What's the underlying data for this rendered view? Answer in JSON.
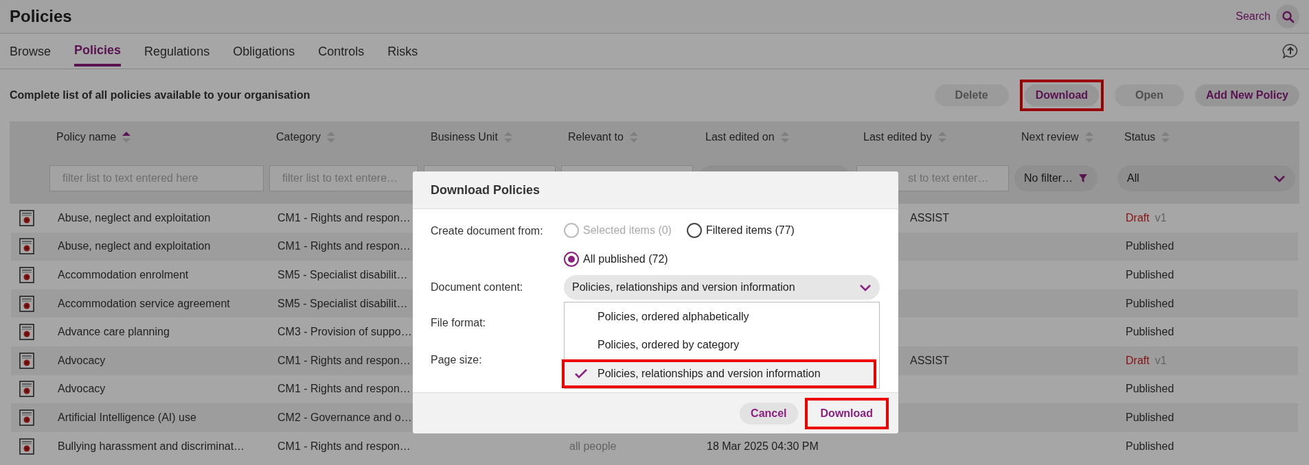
{
  "header": {
    "title": "Policies",
    "search_label": "Search"
  },
  "tabs": [
    {
      "label": "Browse",
      "selected": false
    },
    {
      "label": "Policies",
      "selected": true
    },
    {
      "label": "Regulations",
      "selected": false
    },
    {
      "label": "Obligations",
      "selected": false
    },
    {
      "label": "Controls",
      "selected": false
    },
    {
      "label": "Risks",
      "selected": false
    }
  ],
  "toolbar": {
    "description": "Complete list of all policies available to your organisation",
    "buttons": [
      {
        "label": "Delete",
        "disabled": true,
        "highlighted": false
      },
      {
        "label": "Download",
        "disabled": false,
        "highlighted": true
      },
      {
        "label": "Open",
        "disabled": true,
        "highlighted": false
      },
      {
        "label": "Add New Policy",
        "disabled": false,
        "highlighted": false
      }
    ]
  },
  "table": {
    "columns": [
      {
        "label": "Policy name",
        "sorted_ascending": true
      },
      {
        "label": "Category",
        "sorted_ascending": false
      },
      {
        "label": "Business Unit",
        "sorted_ascending": false
      },
      {
        "label": "Relevant to",
        "sorted_ascending": false
      },
      {
        "label": "Last edited on",
        "sorted_ascending": false
      },
      {
        "label": "Last edited by",
        "sorted_ascending": false
      },
      {
        "label": "Next review",
        "sorted_ascending": false
      },
      {
        "label": "Status",
        "sorted_ascending": false
      }
    ],
    "filters": [
      {
        "kind": "text",
        "placeholder": "filter list to text entered here"
      },
      {
        "kind": "text",
        "placeholder": "filter list to text entere…"
      },
      {
        "kind": "text"
      },
      {
        "kind": "text"
      },
      {
        "kind": "pill"
      },
      {
        "kind": "text",
        "placeholder": "st to text enter…"
      },
      {
        "kind": "funnel",
        "value": "No filter…"
      },
      {
        "kind": "select",
        "value": "All"
      }
    ],
    "rows": [
      {
        "policy_name": "Abuse, neglect and exploitation",
        "category": "CM1 - Rights and respon…",
        "last_edited_by": "ASSIST",
        "status": {
          "kind": "draft",
          "label": "Draft",
          "version": "v1"
        }
      },
      {
        "policy_name": "Abuse, neglect and exploitation",
        "category": "CM1 - Rights and respon…",
        "status": {
          "kind": "published",
          "label": "Published"
        }
      },
      {
        "policy_name": "Accommodation enrolment",
        "category": "SM5 - Specialist disabilit…",
        "status": {
          "kind": "published",
          "label": "Published"
        }
      },
      {
        "policy_name": "Accommodation service agreement",
        "category": "SM5 - Specialist disabilit…",
        "status": {
          "kind": "published",
          "label": "Published"
        }
      },
      {
        "policy_name": "Advance care planning",
        "category": "CM3 - Provision of suppo…",
        "status": {
          "kind": "published",
          "label": "Published"
        }
      },
      {
        "policy_name": "Advocacy",
        "category": "CM1 - Rights and respon…",
        "last_edited_by": "ASSIST",
        "status": {
          "kind": "draft",
          "label": "Draft",
          "version": "v1"
        }
      },
      {
        "policy_name": "Advocacy",
        "category": "CM1 - Rights and respon…",
        "status": {
          "kind": "published",
          "label": "Published"
        }
      },
      {
        "policy_name": "Artificial Intelligence (AI) use",
        "category": "CM2 - Governance and o…",
        "status": {
          "kind": "published",
          "label": "Published"
        }
      },
      {
        "policy_name": "Bullying harassment and discriminat…",
        "category": "CM1 - Rights and respon…",
        "relevant_to": "all people",
        "last_edited_on": "18 Mar 2025 04:30 PM",
        "status": {
          "kind": "published",
          "label": "Published"
        }
      }
    ]
  },
  "dialog": {
    "title": "Download Policies",
    "create_from": {
      "label": "Create document from:",
      "options": [
        {
          "label": "Selected items (0)",
          "selected": false,
          "disabled": true
        },
        {
          "label": "Filtered items (77)",
          "selected": false,
          "disabled": false
        },
        {
          "label": "All published (72)",
          "selected": true,
          "disabled": false
        }
      ]
    },
    "document_content": {
      "label": "Document content:",
      "value": "Policies, relationships and version information",
      "options": [
        {
          "label": "Policies, ordered alphabetically",
          "selected": false,
          "highlighted": false
        },
        {
          "label": "Policies, ordered by category",
          "selected": false,
          "highlighted": false
        },
        {
          "label": "Policies, relationships and version information",
          "selected": true,
          "highlighted": true
        }
      ]
    },
    "file_format": {
      "label": "File format:"
    },
    "page_size": {
      "label": "Page size:"
    },
    "buttons": [
      {
        "label": "Cancel",
        "highlighted": false
      },
      {
        "label": "Download",
        "highlighted": true
      }
    ]
  }
}
